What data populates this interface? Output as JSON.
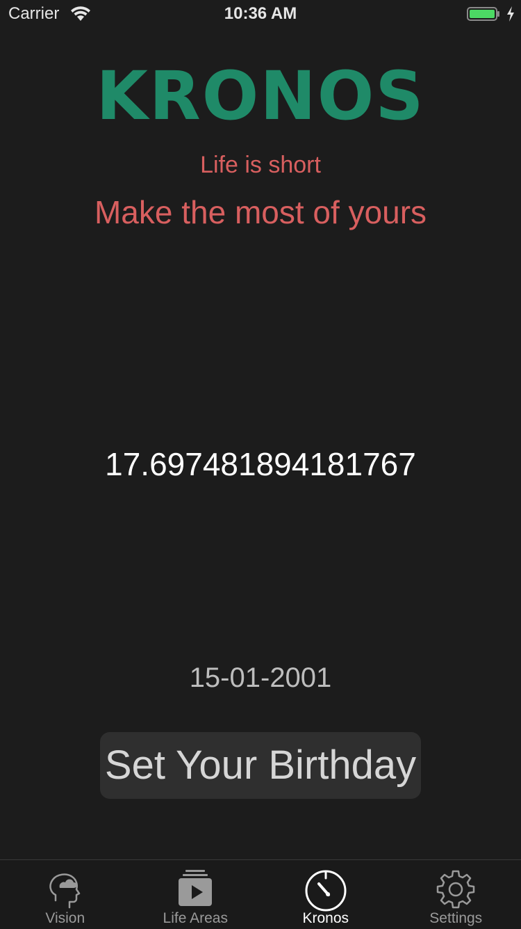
{
  "status_bar": {
    "carrier": "Carrier",
    "time": "10:36 AM",
    "battery_color": "#4cd964"
  },
  "main": {
    "title": "KRONOS",
    "tagline_1": "Life is short",
    "tagline_2": "Make the most of yours",
    "age_value": "17.697481894181767",
    "birthday_date": "15-01-2001",
    "set_birthday_label": "Set Your Birthday"
  },
  "colors": {
    "background": "#1c1c1c",
    "title": "#1f8a68",
    "tagline": "#d85f5f",
    "button_bg": "#2f2f2f"
  },
  "tab_bar": {
    "tabs": [
      {
        "label": "Vision",
        "icon": "head-cloud-icon",
        "active": false
      },
      {
        "label": "Life Areas",
        "icon": "play-stack-icon",
        "active": false
      },
      {
        "label": "Kronos",
        "icon": "stopwatch-icon",
        "active": true
      },
      {
        "label": "Settings",
        "icon": "gear-icon",
        "active": false
      }
    ]
  }
}
